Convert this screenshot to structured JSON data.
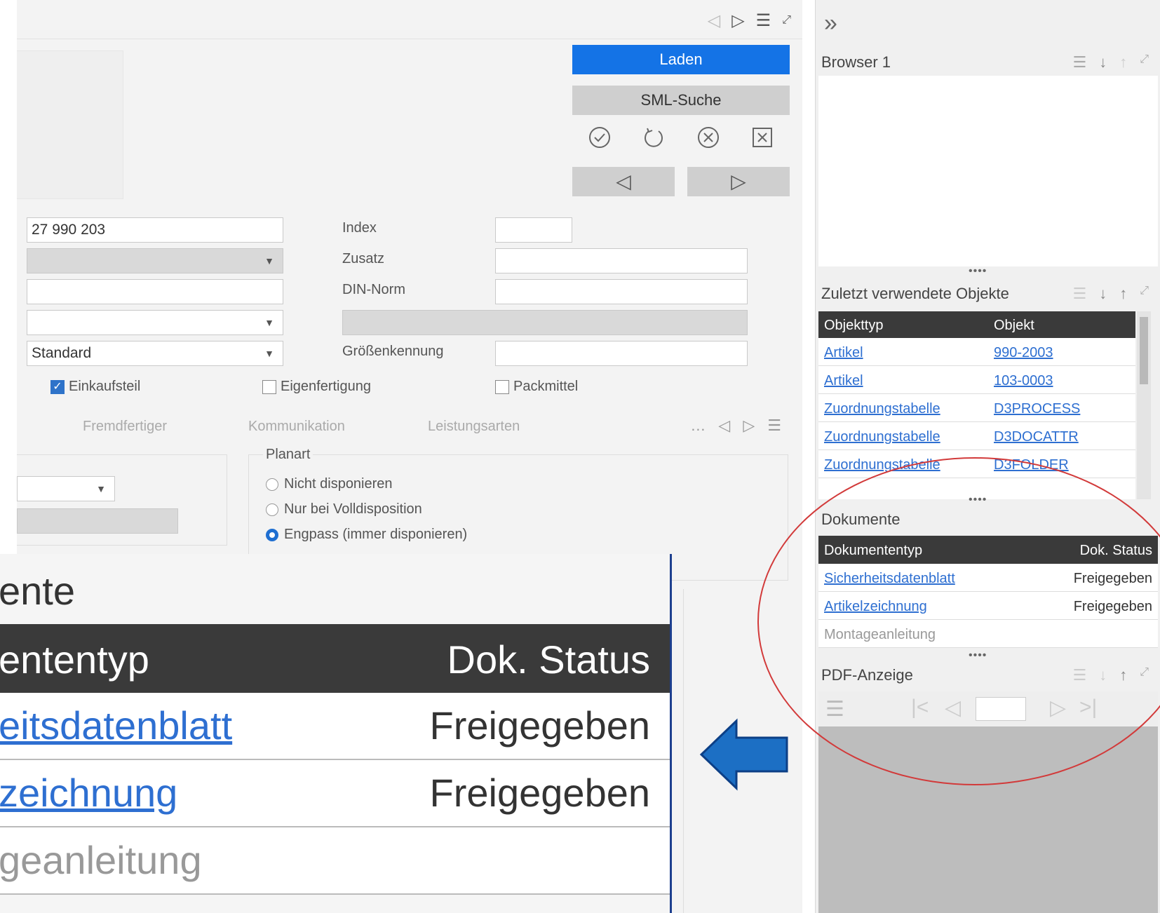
{
  "main": {
    "load_button": "Laden",
    "sml_search_button": "SML-Suche",
    "fields": {
      "number": "27 990 203",
      "standard_select": "Standard",
      "index_label": "Index",
      "zusatz_label": "Zusatz",
      "din_label": "DIN-Norm",
      "groesse_label": "Größenkennung"
    },
    "checkboxes": {
      "einkaufsteil": "Einkaufsteil",
      "eigenfertigung": "Eigenfertigung",
      "packmittel": "Packmittel"
    },
    "tabs": [
      "Fremdfertiger",
      "Kommunikation",
      "Leistungsarten"
    ],
    "planart": {
      "label": "Planart",
      "options": [
        "Nicht disponieren",
        "Nur bei Volldisposition",
        "Engpass (immer disponieren)"
      ],
      "selected": 2
    }
  },
  "sidebar": {
    "browser_title": "Browser 1",
    "recent_title": "Zuletzt verwendete Objekte",
    "recent_headers": [
      "Objekttyp",
      "Objekt"
    ],
    "recent_rows": [
      {
        "type": "Artikel",
        "object": "990-2003"
      },
      {
        "type": "Artikel",
        "object": "103-0003"
      },
      {
        "type": "Zuordnungstabelle",
        "object": "D3PROCESS"
      },
      {
        "type": "Zuordnungstabelle",
        "object": "D3DOCATTR"
      },
      {
        "type": "Zuordnungstabelle",
        "object": "D3FOLDER"
      }
    ],
    "docs_title": "Dokumente",
    "docs_headers": [
      "Dokumententyp",
      "Dok. Status"
    ],
    "docs_rows": [
      {
        "type": "Sicherheitsdatenblatt",
        "status": "Freigegeben"
      },
      {
        "type": "Artikelzeichnung",
        "status": "Freigegeben"
      },
      {
        "type": "Montageanleitung",
        "status": ""
      }
    ],
    "pdf_title": "PDF-Anzeige"
  },
  "zoom": {
    "title": "ente",
    "header_type": "ententyp",
    "header_status": "Dok. Status",
    "rows": [
      {
        "type": "eitsdatenblatt",
        "status": "Freigegeben"
      },
      {
        "type": "zeichnung",
        "status": "Freigegeben"
      },
      {
        "type": "geanleitung",
        "status": ""
      }
    ]
  },
  "colors": {
    "accent": "#1473e6",
    "header_dark": "#3a3a3a",
    "link": "#2e6fd1",
    "annotation_red": "#d23a3a",
    "arrow_blue": "#1c6fc4"
  }
}
